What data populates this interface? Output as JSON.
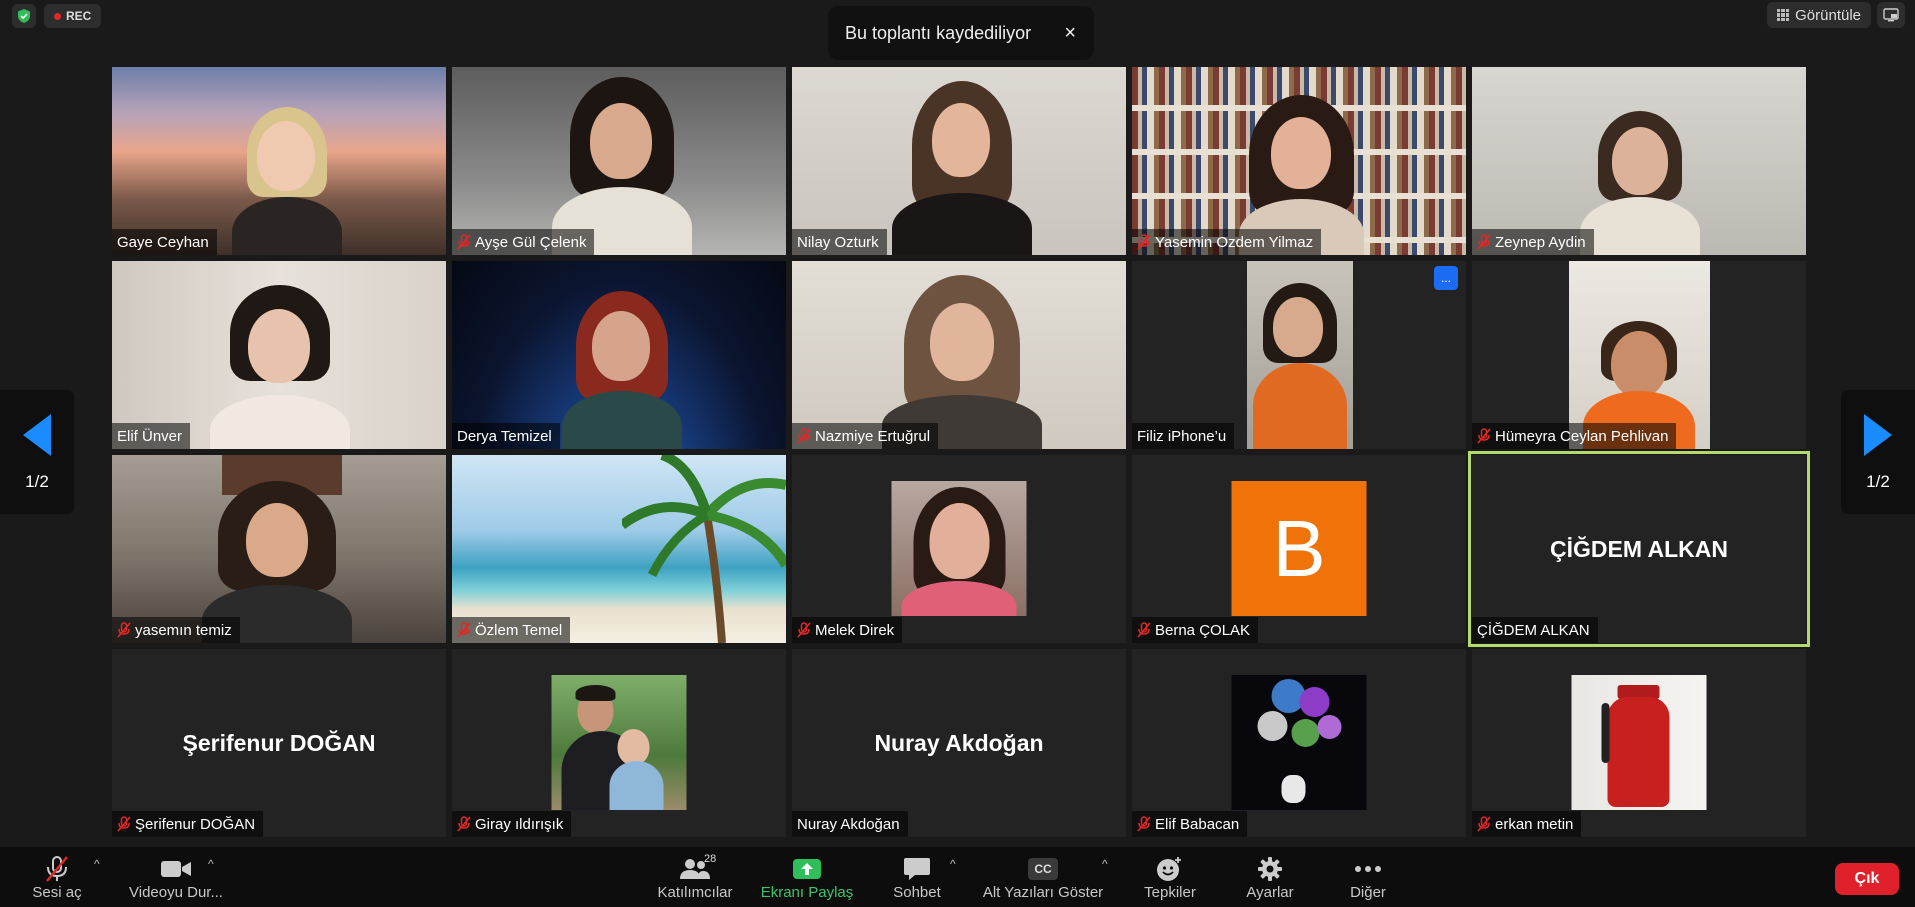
{
  "top": {
    "rec_label": "REC",
    "toast_text": "Bu toplantı kaydediliyor",
    "toast_close": "×",
    "view_label": "Görüntüle"
  },
  "nav": {
    "page_left": "1/2",
    "page_right": "1/2"
  },
  "participants": [
    {
      "name": "Gaye Ceyhan",
      "muted": false
    },
    {
      "name": "Ayşe Gül Çelenk",
      "muted": true
    },
    {
      "name": "Nilay Ozturk",
      "muted": false
    },
    {
      "name": "Yasemin Ozdem Yilmaz",
      "muted": true
    },
    {
      "name": "Zeynep Aydin",
      "muted": true
    },
    {
      "name": "Elif Ünver",
      "muted": false
    },
    {
      "name": "Derya Temizel",
      "muted": false
    },
    {
      "name": "Nazmiye Ertuğrul",
      "muted": true
    },
    {
      "name": "Filiz iPhone’u",
      "muted": false,
      "more_label": "..."
    },
    {
      "name": "Hümeyra Ceylan Pehlivan",
      "muted": true
    },
    {
      "name": "yasemın temiz",
      "muted": true
    },
    {
      "name": "Özlem Temel",
      "muted": true
    },
    {
      "name": "Melek Direk",
      "muted": true
    },
    {
      "name": "Berna ÇOLAK",
      "muted": true,
      "avatar_letter": "B"
    },
    {
      "name": "ÇİĞDEM ALKAN",
      "muted": false,
      "center_name": "ÇİĞDEM ALKAN",
      "active": true
    },
    {
      "name": "Şerifenur DOĞAN",
      "muted": true,
      "center_name": "Şerifenur DOĞAN"
    },
    {
      "name": "Giray ıldırışık",
      "muted": true
    },
    {
      "name": "Nuray Akdoğan",
      "muted": false,
      "center_name": "Nuray Akdoğan"
    },
    {
      "name": "Elif Babacan",
      "muted": true
    },
    {
      "name": "erkan metin",
      "muted": true
    }
  ],
  "toolbar": {
    "audio": "Sesi aç",
    "video": "Videoyu Dur...",
    "participants": "Katılımcılar",
    "participants_count": "28",
    "share": "Ekranı Paylaş",
    "chat": "Sohbet",
    "captions": "Alt Yazıları Göster",
    "captions_icon_text": "CC",
    "reactions": "Tepkiler",
    "settings": "Ayarlar",
    "more": "Diğer",
    "leave": "Çık"
  },
  "colors": {
    "accent_green": "#3dc46a",
    "active_border": "#b6d96c",
    "leave_red": "#e0212b",
    "nav_blue": "#1a8cff",
    "more_blue": "#1b6cf2",
    "rec_red": "#e02828",
    "avatar_orange": "#f0730a"
  }
}
